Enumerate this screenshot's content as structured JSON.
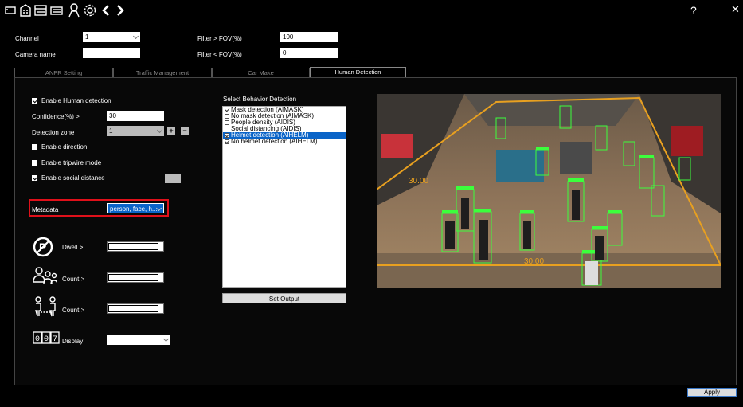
{
  "toolbar": {
    "icons": [
      "window-icon",
      "building-icon",
      "calendar-icon",
      "keyboard-icon",
      "person-icon",
      "settings-icon",
      "back-icon",
      "forward-icon"
    ],
    "help_label": "?",
    "minimize_label": "—",
    "close_label": "✕"
  },
  "filters": {
    "channel_label": "Channel",
    "channel_value": "1",
    "camera_name_label": "Camera name",
    "camera_name_value": "",
    "fov_gt_label": "Filter > FOV(%)",
    "fov_gt_value": "100",
    "fov_lt_label": "Filter < FOV(%)",
    "fov_lt_value": "0"
  },
  "tabs": [
    {
      "label": "ANPR Setting",
      "active": false
    },
    {
      "label": "Traffic Management",
      "active": false
    },
    {
      "label": "Car Make",
      "active": false
    },
    {
      "label": "Human Detection",
      "active": true
    }
  ],
  "settings": {
    "enable_human_detection": {
      "label": "Enable Human detection",
      "checked": true
    },
    "confidence_label": "Confidence(%) >",
    "confidence_value": "30",
    "detection_zone_label": "Detection zone",
    "detection_zone_value": "1",
    "zone_add": "+",
    "zone_remove": "−",
    "enable_direction": {
      "label": "Enable direction",
      "checked": false
    },
    "enable_tripwire": {
      "label": "Enable tripwire mode",
      "checked": false
    },
    "enable_social_distance": {
      "label": "Enable social distance",
      "checked": true
    },
    "social_distance_button": "...",
    "metadata_label": "Metadata",
    "metadata_value": "person, face, h...",
    "dwell_label": "Dwell >",
    "count1_label": "Count >",
    "count2_label": "Count >",
    "display_label": "Display"
  },
  "behavior": {
    "title": "Select Behavior Detection",
    "items": [
      {
        "label": "Mask detection (AIMASK)",
        "checked": true,
        "selected": false
      },
      {
        "label": "No mask detection (AIMASK)",
        "checked": false,
        "selected": false
      },
      {
        "label": "People density (AIDIS)",
        "checked": false,
        "selected": false
      },
      {
        "label": "Social distancing (AIDIS)",
        "checked": false,
        "selected": false
      },
      {
        "label": "Helmet detection (AIHELM)",
        "checked": true,
        "selected": true
      },
      {
        "label": "No helmet detection (AIHELM)",
        "checked": true,
        "selected": false
      }
    ],
    "set_output_label": "Set Output"
  },
  "video": {
    "label_left": "30.00",
    "label_bottom": "30.00"
  },
  "apply_label": "Apply",
  "colors": {
    "highlight_box": "#e0101a",
    "selection": "#0a64c8",
    "detection_green": "#3cff3c",
    "zone_orange": "#e8a020"
  }
}
